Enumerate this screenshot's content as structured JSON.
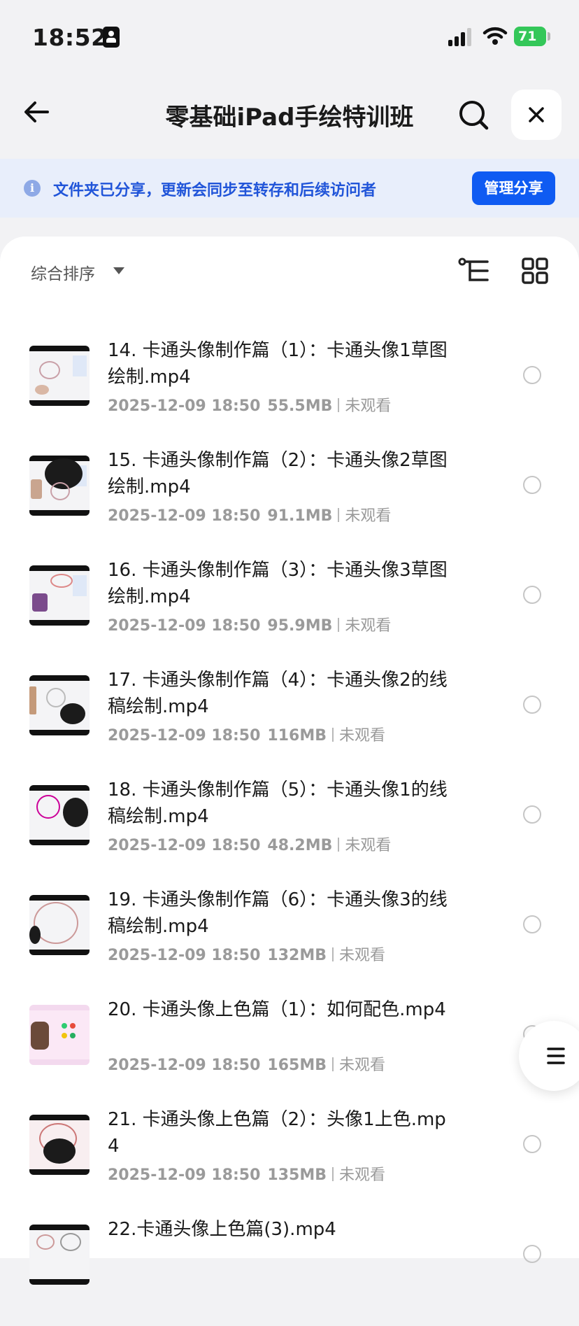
{
  "status_bar": {
    "time": "18:52",
    "battery": "71"
  },
  "header": {
    "title": "零基础iPad手绘特训班"
  },
  "banner": {
    "text": "文件夹已分享，更新会同步至转存和后续访问者",
    "button": "管理分享"
  },
  "toolbar": {
    "sort_label": "综合排序"
  },
  "files": [
    {
      "name": "14. 卡通头像制作篇（1）：卡通头像1草图绘制.mp4",
      "date": "2025-12-09 18:50",
      "size": "55.5MB",
      "status": "未观看"
    },
    {
      "name": "15. 卡通头像制作篇（2）：卡通头像2草图绘制.mp4",
      "date": "2025-12-09 18:50",
      "size": "91.1MB",
      "status": "未观看"
    },
    {
      "name": "16. 卡通头像制作篇（3）：卡通头像3草图绘制.mp4",
      "date": "2025-12-09 18:50",
      "size": "95.9MB",
      "status": "未观看"
    },
    {
      "name": "17. 卡通头像制作篇（4）：卡通头像2的线稿绘制.mp4",
      "date": "2025-12-09 18:50",
      "size": "116MB",
      "status": "未观看"
    },
    {
      "name": "18. 卡通头像制作篇（5）：卡通头像1的线稿绘制.mp4",
      "date": "2025-12-09 18:50",
      "size": "48.2MB",
      "status": "未观看"
    },
    {
      "name": "19. 卡通头像制作篇（6）：卡通头像3的线稿绘制.mp4",
      "date": "2025-12-09 18:50",
      "size": "132MB",
      "status": "未观看"
    },
    {
      "name": "20. 卡通头像上色篇（1）：如何配色.mp4",
      "date": "2025-12-09 18:50",
      "size": "165MB",
      "status": "未观看"
    },
    {
      "name": "21. 卡通头像上色篇（2）：头像1上色.mp4",
      "date": "2025-12-09 18:50",
      "size": "135MB",
      "status": "未观看"
    },
    {
      "name": "22.卡通头像上色篇(3).mp4",
      "date": "",
      "size": "",
      "status": ""
    }
  ],
  "colors": {
    "accent": "#0f5bf2",
    "banner_bg": "#e8eefb",
    "banner_text": "#2155d9",
    "battery": "#34c759"
  }
}
